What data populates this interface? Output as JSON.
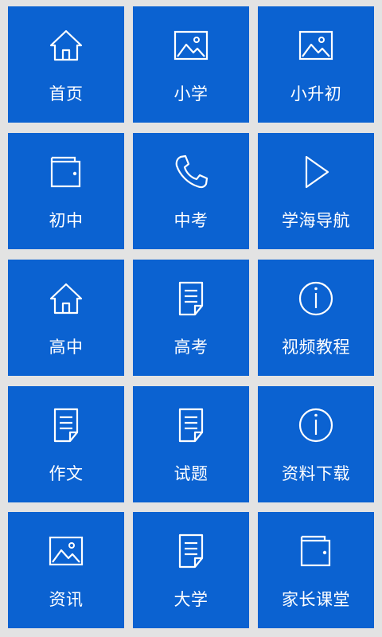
{
  "accent_color": "#0b62d1",
  "background_color": "#e3e3e3",
  "menu": {
    "items": [
      {
        "label": "首页",
        "icon": "home-icon"
      },
      {
        "label": "小学",
        "icon": "image-icon"
      },
      {
        "label": "小升初",
        "icon": "image-icon"
      },
      {
        "label": "初中",
        "icon": "wallet-icon"
      },
      {
        "label": "中考",
        "icon": "phone-icon"
      },
      {
        "label": "学海导航",
        "icon": "play-icon"
      },
      {
        "label": "高中",
        "icon": "home-icon"
      },
      {
        "label": "高考",
        "icon": "document-icon"
      },
      {
        "label": "视频教程",
        "icon": "info-icon"
      },
      {
        "label": "作文",
        "icon": "document-icon"
      },
      {
        "label": "试题",
        "icon": "document-icon"
      },
      {
        "label": "资料下载",
        "icon": "info-icon"
      },
      {
        "label": "资讯",
        "icon": "image-icon"
      },
      {
        "label": "大学",
        "icon": "document-icon"
      },
      {
        "label": "家长课堂",
        "icon": "wallet-icon"
      }
    ]
  }
}
